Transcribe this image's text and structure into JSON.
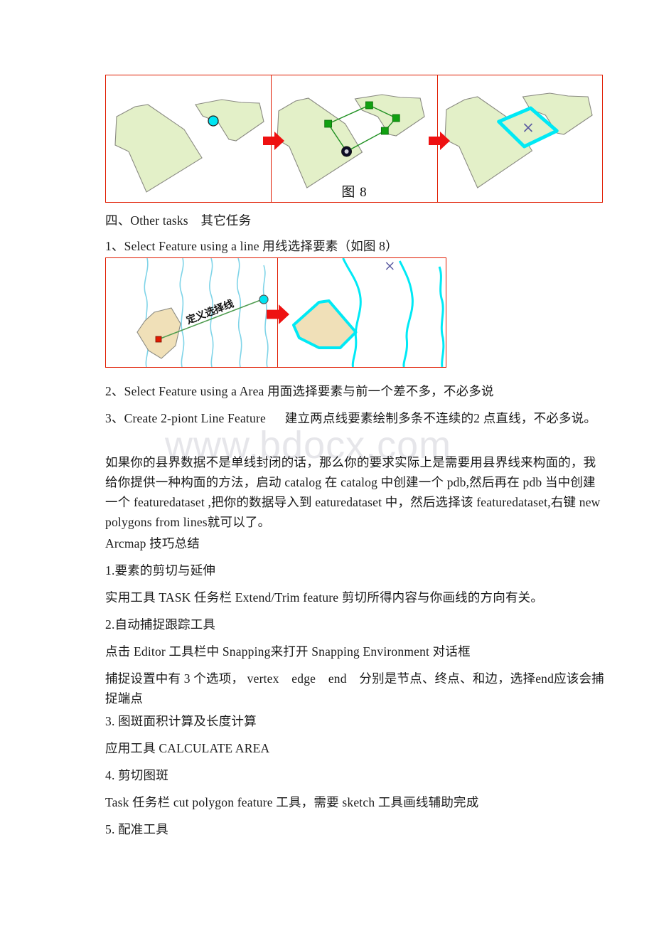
{
  "document": {
    "watermark": "www.bdocx.com",
    "colors": {
      "figure_border": "#e01b00",
      "arrow_red": "#ee1111",
      "polygon_green_fill": "#e3f0c8",
      "polygon_tan_fill": "#f0e0b8",
      "selection_cyan": "#00e9f5",
      "sketch_green": "#1f9021",
      "vertex_green": "#11a011",
      "contour_blue": "#7fd4e8",
      "x_marker_blue": "#5a5aa0"
    }
  },
  "figure_8": {
    "name": "图 8",
    "caption": "图 8",
    "panels": [
      {
        "label": "panel-1-before-sketch"
      },
      {
        "label": "panel-2-sketch-line",
        "caption": "图 8"
      },
      {
        "label": "panel-3-selected-result"
      }
    ]
  },
  "figure_line_select": {
    "panels": [
      {
        "label": "panel-1-draw-line",
        "annotation": "定义选择线"
      },
      {
        "label": "panel-2-selected-polygon"
      }
    ]
  },
  "body": {
    "heading_other_tasks": "四、Other tasks　其它任务",
    "item_1": "1、Select Feature using a line 用线选择要素（如图 8）",
    "item_2": "2、Select Feature using a Area 用面选择要素与前一个差不多，不必多说",
    "item_3": "3、Create 2-piont Line Feature 　 建立两点线要素绘制多条不连续的2 点直线，不必多说。",
    "paragraph_county": "如果你的县界数据不是单线封闭的话，那么你的要求实际上是需要用县界线来构面的，我给你提供一种构面的方法，启动 catalog 在 catalog 中创建一个 pdb,然后再在 pdb 当中创建一个 featuredataset ,把你的数据导入到 eaturedataset 中，然后选择该 featuredataset,右键 new polygons from lines就可以了。",
    "heading_arcmap": "Arcmap 技巧总结",
    "tip_1_title": "1.要素的剪切与延伸",
    "tip_1_body": "实用工具 TASK 任务栏 Extend/Trim feature 剪切所得内容与你画线的方向有关。",
    "tip_2_title": "2.自动捕捉跟踪工具",
    "tip_2_body_a": "点击 Editor 工具栏中 Snapping来打开 Snapping Environment 对话框",
    "tip_2_body_b": "捕捉设置中有 3 个选项， vertex　edge　end　分别是节点、终点、和边，选择end应该会捕捉端点",
    "tip_3_title": "3. 图斑面积计算及长度计算",
    "tip_3_body": "应用工具 CALCULATE AREA",
    "tip_4_title": "4. 剪切图斑",
    "tip_4_body": "Task 任务栏 cut polygon feature 工具，需要 sketch 工具画线辅助完成",
    "tip_5_title": "5. 配准工具"
  }
}
